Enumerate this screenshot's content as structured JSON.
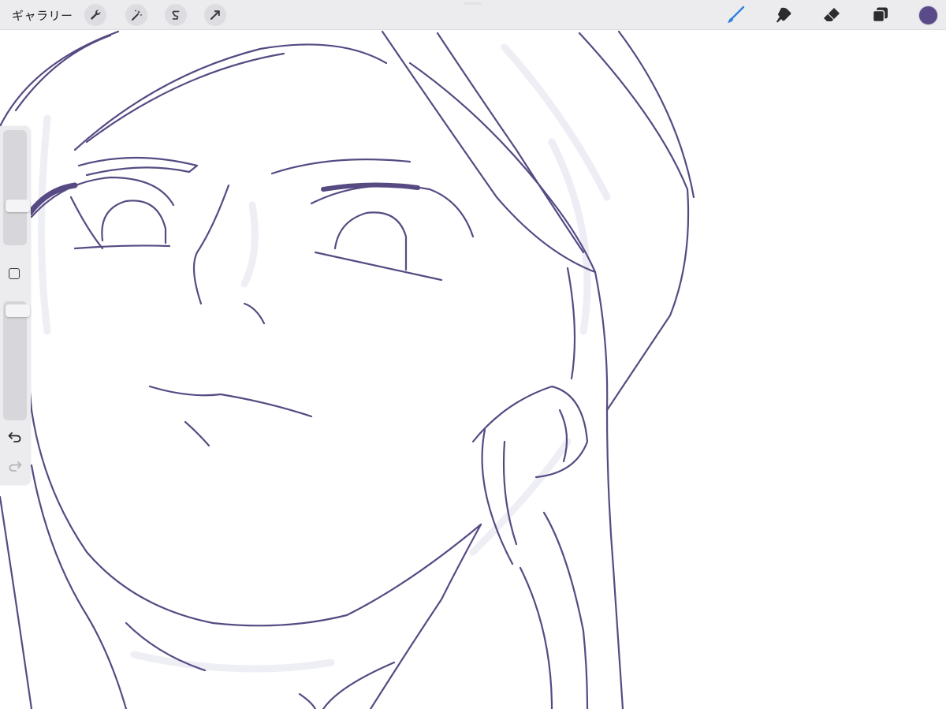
{
  "topbar": {
    "gallery_label": "ギャラリー",
    "left_tools": [
      {
        "icon": "wrench-icon",
        "name": "actions"
      },
      {
        "icon": "magic-wand-icon",
        "name": "adjustments"
      },
      {
        "icon": "selection-s-icon",
        "name": "selection"
      },
      {
        "icon": "transform-arrow-icon",
        "name": "transform"
      }
    ],
    "right_tools": [
      {
        "icon": "brush-icon",
        "name": "paint",
        "active": true
      },
      {
        "icon": "smudge-icon",
        "name": "smudge"
      },
      {
        "icon": "eraser-icon",
        "name": "eraser"
      },
      {
        "icon": "layers-icon",
        "name": "layers"
      }
    ],
    "current_color": "#5b4a8a"
  },
  "colors": {
    "toolbar_bg": "#ececef",
    "active_tool": "#2f7fe0",
    "ink": "#574a83"
  },
  "sidebar": {
    "brush_size": 0.32,
    "brush_opacity": 0.97,
    "icons": [
      "modifier-square-icon",
      "undo-icon",
      "redo-icon"
    ]
  }
}
